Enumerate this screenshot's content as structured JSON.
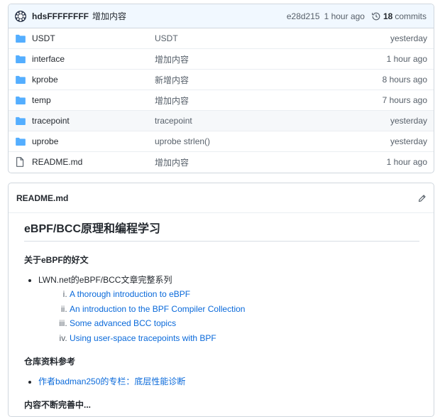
{
  "commit": {
    "author": "hdsFFFFFFFF",
    "message": "增加内容",
    "sha": "e28d215",
    "time": "1 hour ago",
    "commits_count": "18",
    "commits_label": "commits"
  },
  "files": [
    {
      "type": "folder",
      "name": "USDT",
      "message": "USDT",
      "age": "yesterday"
    },
    {
      "type": "folder",
      "name": "interface",
      "message": "增加内容",
      "age": "1 hour ago"
    },
    {
      "type": "folder",
      "name": "kprobe",
      "message": "新增内容",
      "age": "8 hours ago"
    },
    {
      "type": "folder",
      "name": "temp",
      "message": "增加内容",
      "age": "7 hours ago"
    },
    {
      "type": "folder",
      "name": "tracepoint",
      "message": "tracepoint",
      "age": "yesterday"
    },
    {
      "type": "folder",
      "name": "uprobe",
      "message": "uprobe strlen()",
      "age": "yesterday"
    },
    {
      "type": "file",
      "name": "README.md",
      "message": "增加内容",
      "age": "1 hour ago"
    }
  ],
  "readme": {
    "filename": "README.md",
    "h1": "eBPF/BCC原理和编程学习",
    "section1": "关于eBPF的好文",
    "bullet1": "LWN.net的eBPF/BCC文章完整系列",
    "links": [
      "A thorough introduction to eBPF",
      "An introduction to the BPF Compiler Collection",
      "Some advanced BCC topics",
      "Using user-space tracepoints with BPF"
    ],
    "section2": "仓库资料参考",
    "bullet2": "作者badman250的专栏：底层性能诊断",
    "section3": "内容不断完善中..."
  },
  "colors": {
    "link": "#0969da",
    "folder": "#54aeff",
    "commit_bar": "#f1f8ff"
  },
  "icons": {
    "folder": "folder-icon",
    "file": "file-icon",
    "history": "history-icon",
    "edit": "pencil-icon",
    "avatar": "avatar-icon"
  }
}
